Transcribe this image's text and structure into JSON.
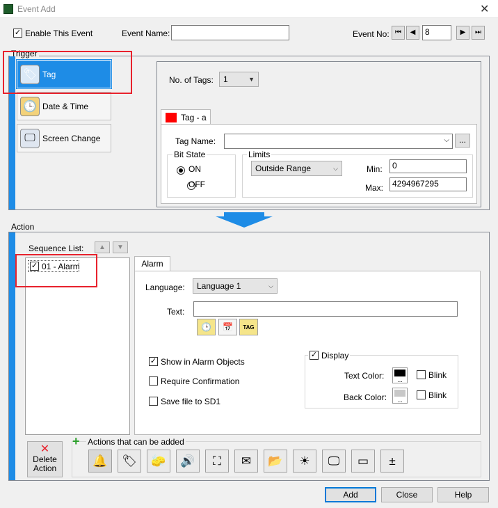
{
  "window": {
    "title": "Event Add",
    "close_glyph": "✕"
  },
  "header": {
    "enable_label": "Enable This Event",
    "enable_checked": true,
    "event_name_label": "Event Name:",
    "event_name_value": "",
    "event_no_label": "Event No:",
    "event_no_value": "8",
    "nav_first": "⏮",
    "nav_prev": "◀",
    "nav_next": "▶",
    "nav_last": "⏭"
  },
  "trigger": {
    "group_label": "Trigger",
    "items": [
      {
        "label": "Tag",
        "icon": "tag-icon",
        "glyph": "🏷",
        "selected": true
      },
      {
        "label": "Date & Time",
        "icon": "clock-icon",
        "glyph": "🕒",
        "selected": false
      },
      {
        "label": "Screen Change",
        "icon": "screen-change-icon",
        "glyph": "🖵",
        "selected": false
      }
    ],
    "no_of_tags_label": "No. of Tags:",
    "no_of_tags_value": "1",
    "tag_tab_label": "Tag - a",
    "tag_name_label": "Tag Name:",
    "tag_name_value": "",
    "browse_label": "...",
    "bit_state_label": "Bit State",
    "on_label": "ON",
    "off_label": "OFF",
    "bit_state_value": "ON",
    "limits_label": "Limits",
    "limits_value": "Outside Range",
    "min_label": "Min:",
    "min_value": "0",
    "max_label": "Max:",
    "max_value": "4294967295"
  },
  "action": {
    "group_label": "Action",
    "sequence_list_label": "Sequence List:",
    "up_glyph": "▲",
    "down_glyph": "▼",
    "sequence_items": [
      {
        "label": "01 - Alarm",
        "checked": true
      }
    ],
    "tab_label": "Alarm",
    "language_label": "Language:",
    "language_value": "Language 1",
    "text_label": "Text:",
    "text_value": "",
    "insert_icons": [
      "clock-insert-icon",
      "calendar-insert-icon",
      "tag-insert-icon"
    ],
    "insert_glyphs": [
      "🕒",
      "📅",
      "TAG"
    ],
    "show_in_alarm_label": "Show in Alarm Objects",
    "show_in_alarm_checked": true,
    "require_confirm_label": "Require Confirmation",
    "require_confirm_checked": false,
    "save_file_label": "Save file to SD1",
    "save_file_checked": false,
    "display_label": "Display",
    "display_checked": true,
    "text_color_label": "Text Color:",
    "text_color": "#000000",
    "back_color_label": "Back Color:",
    "back_color": "#c8c8c8",
    "swatch_dots": "...",
    "blink_label": "Blink",
    "delete_glyph": "✕",
    "delete_label_line1": "Delete",
    "delete_label_line2": "Action",
    "plus_glyph": "+",
    "actions_available_label": "Actions that can be added",
    "action_icons": [
      {
        "name": "alarm-bell-icon",
        "glyph": "🔔"
      },
      {
        "name": "tag-action-icon",
        "glyph": "🏷"
      },
      {
        "name": "erase-tag-icon",
        "glyph": "🧽"
      },
      {
        "name": "sound-icon",
        "glyph": "🔊"
      },
      {
        "name": "screenshot-icon",
        "glyph": "⛶"
      },
      {
        "name": "email-icon",
        "glyph": "✉"
      },
      {
        "name": "folder-icon",
        "glyph": "📂"
      },
      {
        "name": "backlight-icon",
        "glyph": "☀"
      },
      {
        "name": "screen-change-action-icon",
        "glyph": "🖵"
      },
      {
        "name": "window-icon",
        "glyph": "▭"
      },
      {
        "name": "calculation-icon",
        "glyph": "±"
      }
    ]
  },
  "footer": {
    "add_label": "Add",
    "close_label": "Close",
    "help_label": "Help"
  },
  "colors": {
    "accent": "#1e8ce6",
    "highlight_red": "#e8222d",
    "tag_tab_red": "#ff0000",
    "green_plus": "#2ca02c"
  }
}
